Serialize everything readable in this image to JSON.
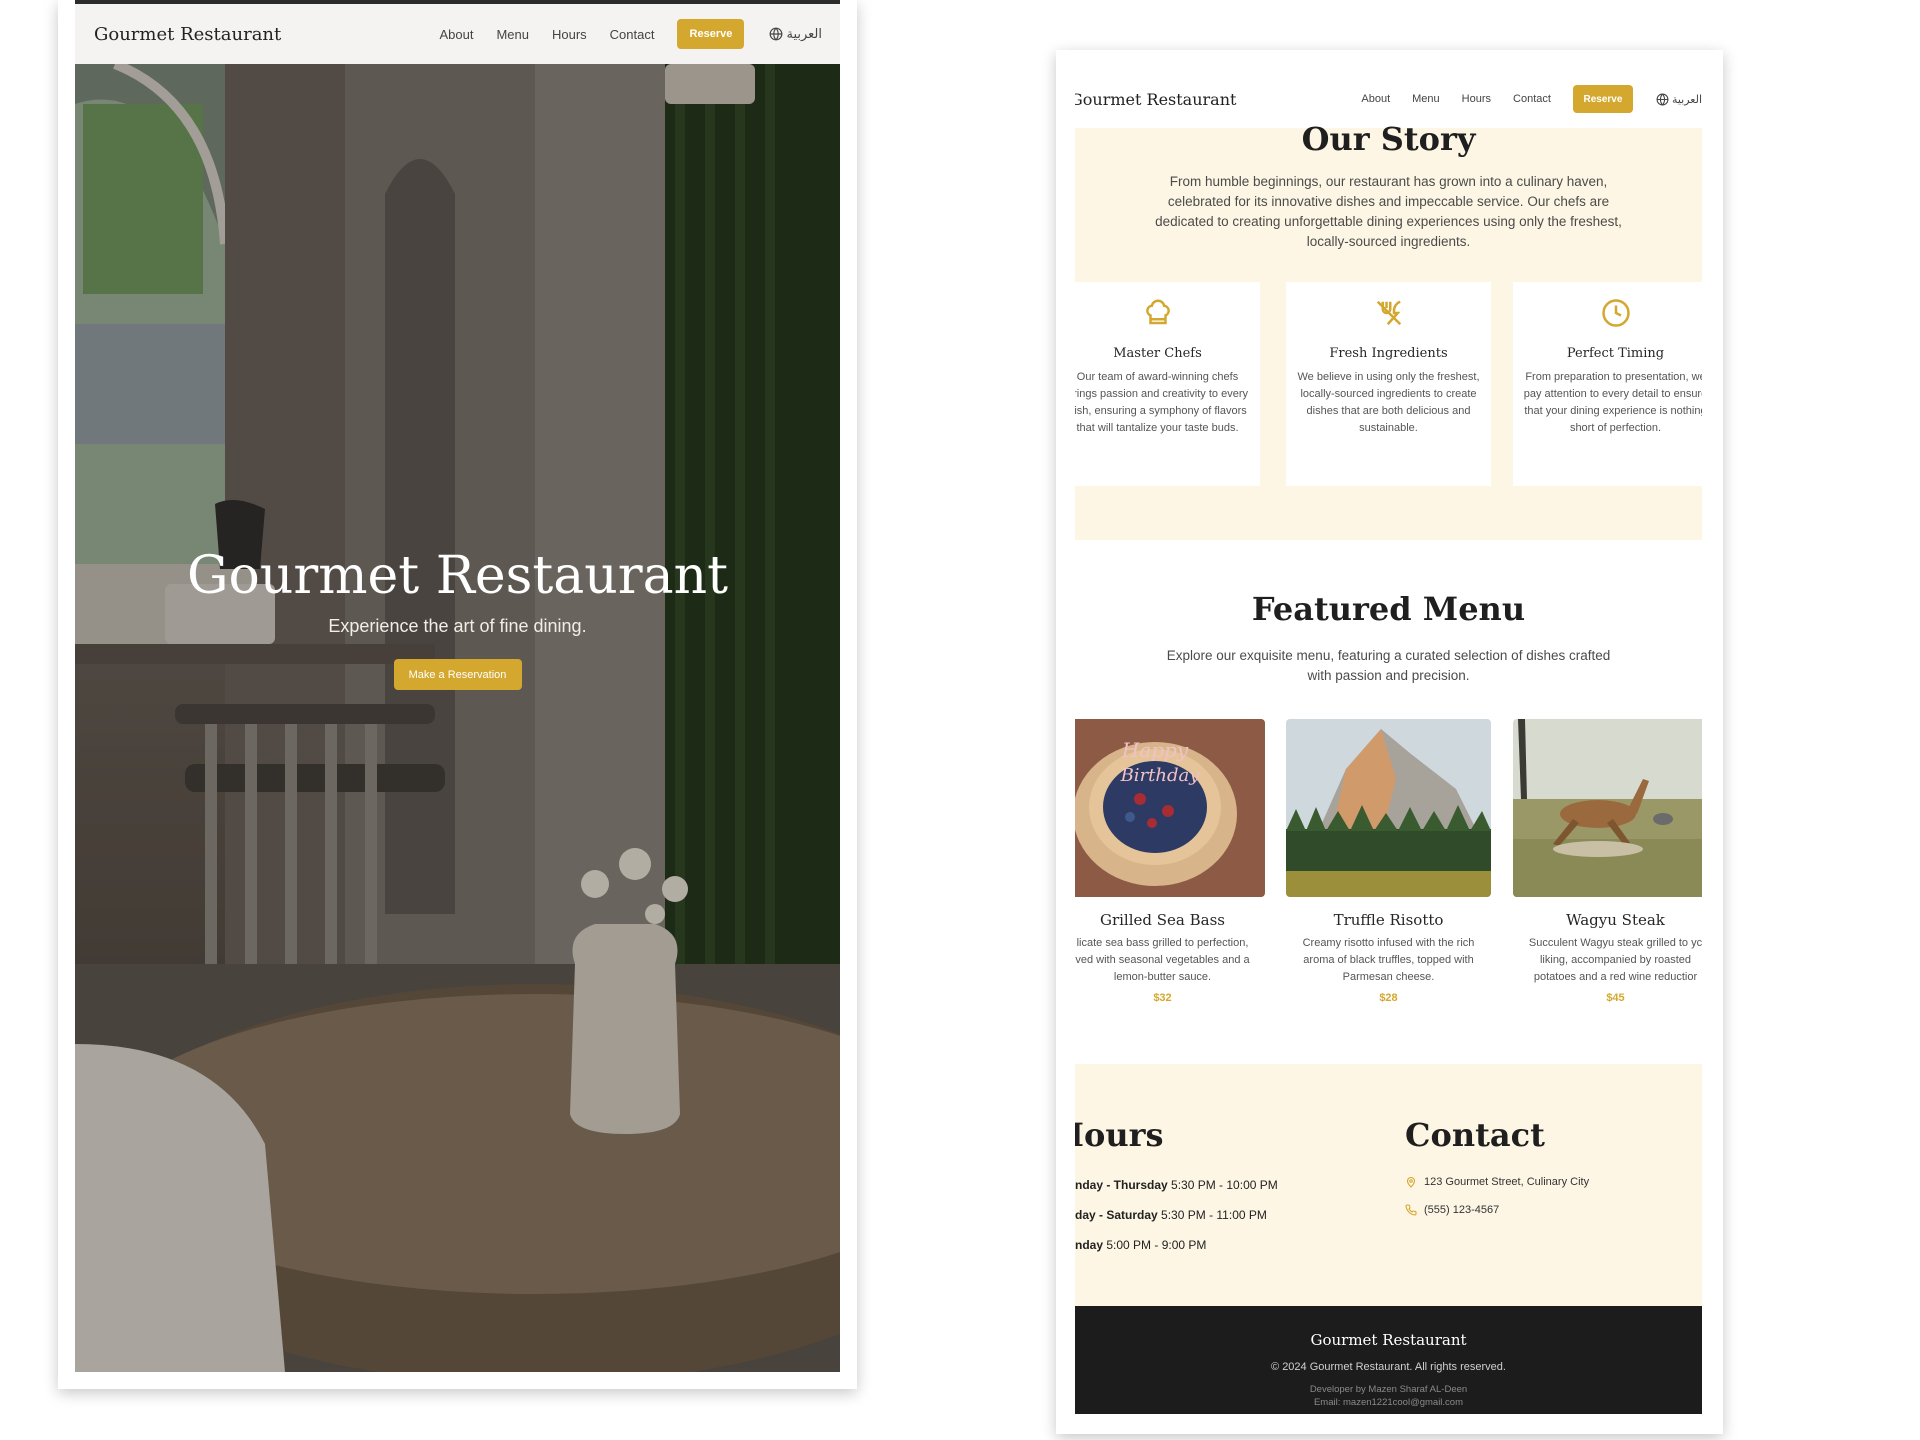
{
  "colors": {
    "accent": "#d4a82f",
    "cream": "#fdf6e4",
    "footer_bg": "#1c1c1c"
  },
  "nav": {
    "brand": "Gourmet Restaurant",
    "links": [
      "About",
      "Menu",
      "Hours",
      "Contact"
    ],
    "reserve_label": "Reserve",
    "lang_label": "العربية",
    "lang_icon": "globe-icon"
  },
  "hero": {
    "title": "Gourmet Restaurant",
    "subtitle": "Experience the art of fine dining.",
    "cta_label": "Make a Reservation"
  },
  "story": {
    "title": "Our Story",
    "text": "From humble beginnings, our restaurant has grown into a culinary haven, celebrated for its innovative dishes and impeccable service. Our chefs are dedicated to creating unforgettable dining experiences using only the freshest, locally-sourced ingredients.",
    "features": [
      {
        "icon": "chef-hat-icon",
        "title": "Master Chefs",
        "text": "Our team of award-winning chefs brings passion and creativity to every dish, ensuring a symphony of flavors that will tantalize your taste buds."
      },
      {
        "icon": "utensils-icon",
        "title": "Fresh Ingredients",
        "text": "We believe in using only the freshest, locally-sourced ingredients to create dishes that are both delicious and sustainable."
      },
      {
        "icon": "clock-icon",
        "title": "Perfect Timing",
        "text": "From preparation to presentation, we pay attention to every detail to ensure that your dining experience is nothing short of perfection."
      }
    ]
  },
  "menu": {
    "title": "Featured Menu",
    "subtitle": "Explore our exquisite menu, featuring a curated selection of dishes crafted with passion and precision.",
    "dishes": [
      {
        "name": "Grilled Sea Bass",
        "desc1": "licate sea bass grilled to perfection,",
        "desc2": "ved with seasonal vegetables and a",
        "desc3": "lemon-butter sauce.",
        "price": "$32"
      },
      {
        "name": "Truffle Risotto",
        "desc1": "Creamy risotto infused with the rich",
        "desc2": "aroma of black truffles, topped with",
        "desc3": "Parmesan cheese.",
        "price": "$28"
      },
      {
        "name": "Wagyu Steak",
        "desc1": "Succulent Wagyu steak grilled to yc",
        "desc2": "liking, accompanied by roasted",
        "desc3": "potatoes and a red wine reductior",
        "price": "$45"
      }
    ]
  },
  "hours": {
    "title": "Iours",
    "rows": [
      {
        "days": "nday - Thursday",
        "time": "5:30 PM - 10:00 PM"
      },
      {
        "days": "day - Saturday",
        "time": "5:30 PM - 11:00 PM"
      },
      {
        "days": "nday",
        "time": "5:00 PM - 9:00 PM"
      }
    ]
  },
  "contact": {
    "title": "Contact",
    "address": "123 Gourmet Street, Culinary City",
    "phone": "(555) 123-4567"
  },
  "footer": {
    "brand": "Gourmet Restaurant",
    "copyright": "© 2024 Gourmet Restaurant. All rights reserved.",
    "developer": "Developer by Mazen Sharaf AL-Deen",
    "email": "Email: mazen1221cool@gmail.com"
  }
}
